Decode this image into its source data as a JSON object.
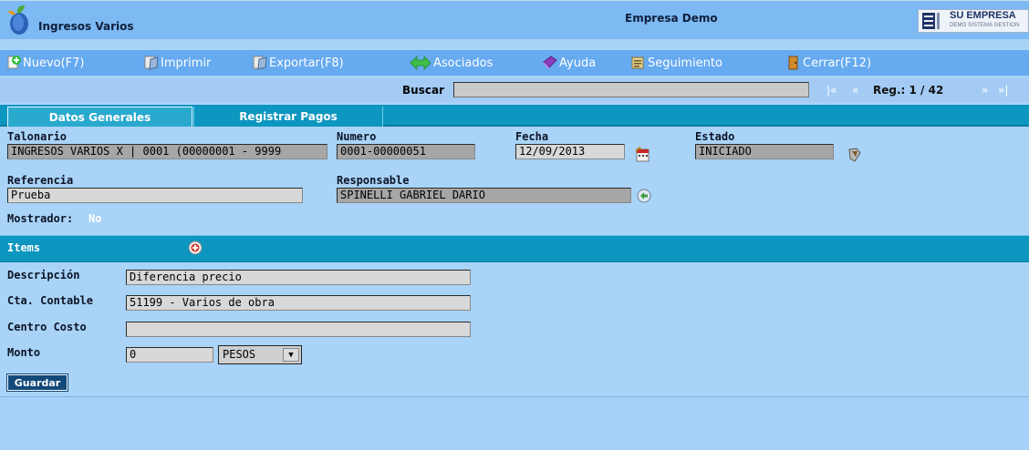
{
  "header": {
    "app_title": "Ingresos Varios",
    "company": "Empresa Demo",
    "brand_name": "SU EMPRESA",
    "brand_sub": "DEMO SISTEMA GESTION"
  },
  "toolbar": {
    "items": [
      {
        "label": "Nuevo(F7)",
        "icon": "new-icon"
      },
      {
        "label": "Imprimir",
        "icon": "print-icon"
      },
      {
        "label": "Exportar(F8)",
        "icon": "export-icon"
      },
      {
        "label": "Asociados",
        "icon": "associates-icon"
      },
      {
        "label": "Ayuda",
        "icon": "help-icon"
      },
      {
        "label": "Seguimiento",
        "icon": "tracking-icon"
      },
      {
        "label": "Cerrar(F12)",
        "icon": "close-icon"
      }
    ]
  },
  "search": {
    "label": "Buscar",
    "value": "",
    "first": "|«",
    "prev": "«",
    "next": "»",
    "last": "»|",
    "record": "Reg.: 1 / 42"
  },
  "tabs": [
    {
      "label": "Datos Generales",
      "active": true
    },
    {
      "label": "Registrar Pagos",
      "active": false
    }
  ],
  "form": {
    "talonario_label": "Talonario",
    "talonario_value": "INGRESOS VARIOS X | 0001 (00000001 - 9999",
    "numero_label": "Numero",
    "numero_value": "0001-00000051",
    "fecha_label": "Fecha",
    "fecha_value": "12/09/2013",
    "estado_label": "Estado",
    "estado_value": "INICIADO",
    "referencia_label": "Referencia",
    "referencia_value": " Prueba",
    "responsable_label": "Responsable",
    "responsable_value": "SPINELLI GABRIEL DARIO",
    "mostrador_label": "Mostrador:",
    "mostrador_value": "No"
  },
  "items": {
    "title": "Items",
    "descripcion_label": "Descripción",
    "descripcion_value": "Diferencia precio",
    "cuenta_label": "Cta. Contable",
    "cuenta_value": "51199 - Varios de obra",
    "centro_label": "Centro Costo",
    "centro_value": "",
    "monto_label": "Monto",
    "monto_value": "0",
    "moneda_value": "PESOS",
    "save_label": "Guardar"
  },
  "colors": {
    "background": "#a9d3f7",
    "toolbar": "#66aaf0",
    "tab_bar": "#0d96bf",
    "button": "#12497a"
  }
}
